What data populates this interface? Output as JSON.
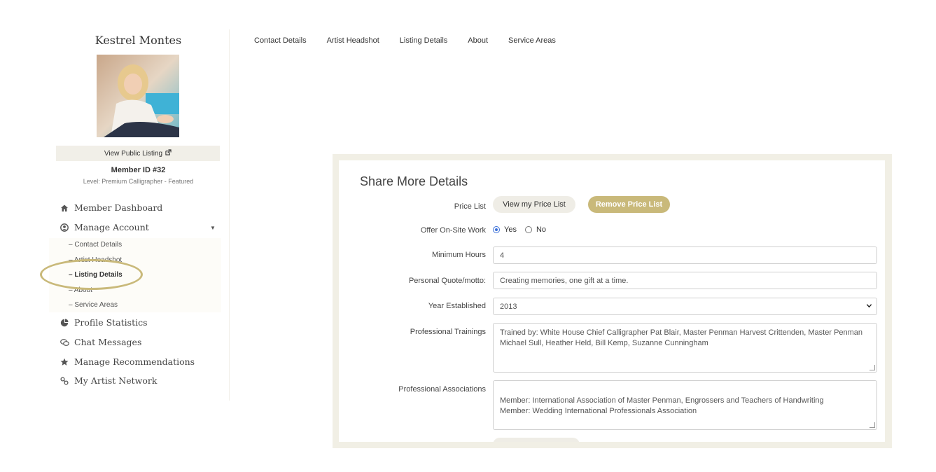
{
  "sidebar": {
    "name": "Kestrel Montes",
    "view_public": "View Public Listing",
    "member_id": "Member ID #32",
    "level": "Level: Premium Calligrapher - Featured",
    "nav": [
      {
        "label": "Member Dashboard",
        "icon": "home-icon"
      },
      {
        "label": "Manage Account",
        "icon": "user-circle-icon"
      },
      {
        "label": "Profile Statistics",
        "icon": "pie-chart-icon"
      },
      {
        "label": "Chat Messages",
        "icon": "chat-icon"
      },
      {
        "label": "Manage Recommendations",
        "icon": "star-icon"
      },
      {
        "label": "My Artist Network",
        "icon": "link-icon"
      }
    ],
    "sub_items": [
      "– Contact Details",
      "– Artist Headshot",
      "– Listing Details",
      "– About",
      "– Service Areas"
    ]
  },
  "tabs": [
    "Contact Details",
    "Artist Headshot",
    "Listing Details",
    "About",
    "Service Areas"
  ],
  "form": {
    "title": "Share More Details",
    "price_list_label": "Price List",
    "view_price_list": "View my Price List",
    "remove_price_list": "Remove Price List",
    "onsite_label": "Offer On-Site Work",
    "yes": "Yes",
    "no": "No",
    "onsite_selected": "Yes",
    "min_hours_label": "Minimum Hours",
    "min_hours_value": "4",
    "quote_label": "Personal Quote/motto:",
    "quote_value": "Creating memories, one gift at a time.",
    "year_label": "Year Established",
    "year_value": "2013",
    "trainings_label": "Professional Trainings",
    "trainings_value": "Trained by: White House Chief Calligrapher Pat Blair, Master Penman Harvest Crittenden, Master Penman Michael Sull, Heather Held, Bill Kemp, Suzanne Cunningham",
    "associations_label": "Professional Associations",
    "associations_value": "Member: International Association of Master Penman, Engrossers and Teachers of Handwriting\nMember: Wedding International Professionals Association"
  },
  "colors": {
    "accent_gold": "#c9b97a",
    "panel_beige": "#f1efe5",
    "radio_blue": "#3a6fd8"
  }
}
